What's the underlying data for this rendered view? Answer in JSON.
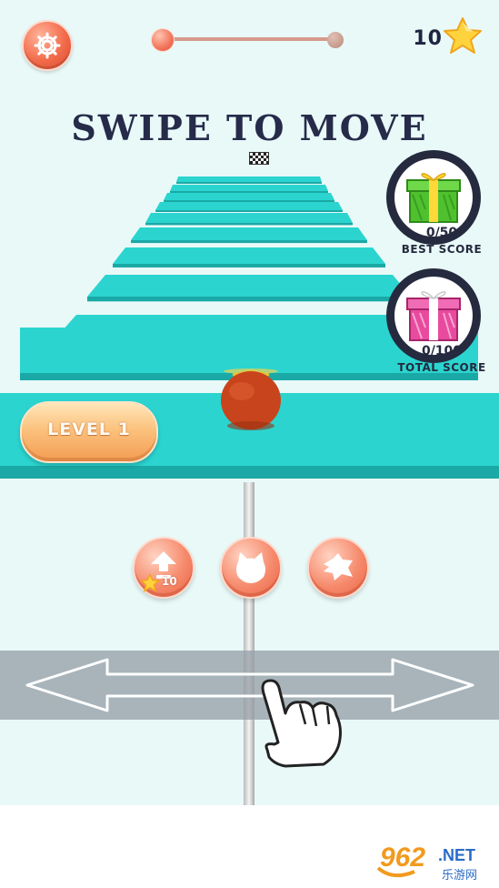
{
  "hud": {
    "coins": "10",
    "level_progress": 0.0,
    "icons": {
      "settings": "gear-icon",
      "coin": "star-icon"
    }
  },
  "title": "SWIPE TO MOVE",
  "rewards": {
    "best": {
      "value": "0/50",
      "label": "BEST SCORE",
      "icon": "green-gift-icon"
    },
    "total": {
      "value": "0/100",
      "label": "TOTAL SCORE",
      "icon": "pink-gift-icon"
    }
  },
  "level": {
    "label": "LEVEL 1"
  },
  "powerups": {
    "upgrade": {
      "icon": "arrow-up-icon",
      "cost": "10",
      "cost_icon": "star-icon"
    },
    "skin": {
      "icon": "cat-face-icon"
    },
    "shape": {
      "icon": "splat-icon"
    }
  },
  "tutorial": {
    "icons": [
      "double-arrow-icon",
      "hand-pointer-icon"
    ]
  },
  "watermark": {
    "text": "962.NET",
    "sub": "乐游网"
  },
  "colors": {
    "track": "#2bd4cf",
    "track_dark": "#1aa9a6",
    "accent": "#f26b4a",
    "text_dark": "#262b4a",
    "player": "#c8441c"
  }
}
